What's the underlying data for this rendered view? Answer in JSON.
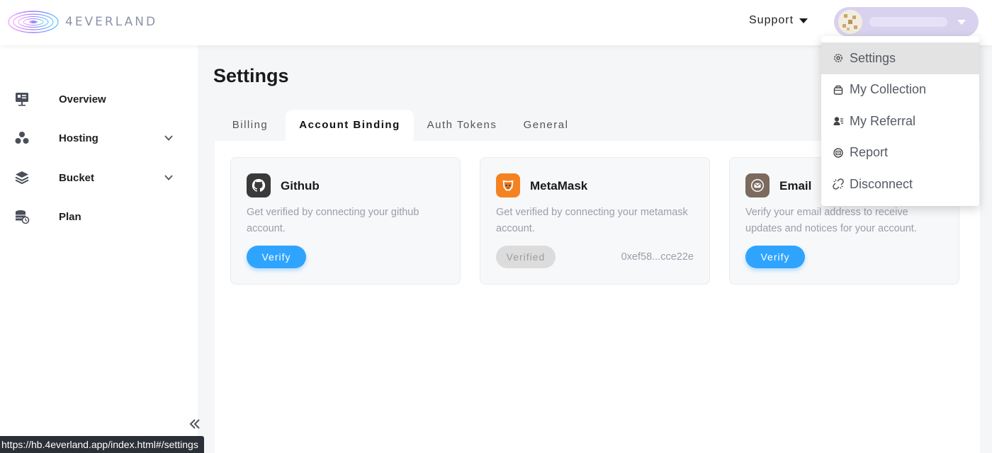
{
  "header": {
    "brand": "4EVERLAND",
    "support_label": "Support"
  },
  "sidebar": {
    "items": [
      {
        "label": "Overview",
        "icon": "overview-icon"
      },
      {
        "label": "Hosting",
        "icon": "hosting-icon",
        "expandable": true
      },
      {
        "label": "Bucket",
        "icon": "bucket-icon",
        "expandable": true
      },
      {
        "label": "Plan",
        "icon": "plan-icon"
      }
    ]
  },
  "main": {
    "title": "Settings",
    "tabs": [
      {
        "label": "Billing"
      },
      {
        "label": "Account Binding",
        "active": true
      },
      {
        "label": "Auth Tokens"
      },
      {
        "label": "General"
      }
    ],
    "cards": [
      {
        "title": "Github",
        "description": "Get verified by connecting your github account.",
        "button": "Verify",
        "icon": "github-icon"
      },
      {
        "title": "MetaMask",
        "description": "Get verified by connecting your metamask account.",
        "button": "Verified",
        "address": "0xef58...cce22e",
        "icon": "metamask-icon"
      },
      {
        "title": "Email",
        "description": "Verify your email address to receive updates and notices for your account.",
        "button": "Verify",
        "icon": "email-icon"
      }
    ]
  },
  "dropdown": {
    "items": [
      {
        "label": "Settings",
        "icon": "gear-icon",
        "active": true
      },
      {
        "label": "My Collection",
        "icon": "collection-icon"
      },
      {
        "label": "My Referral",
        "icon": "referral-icon"
      },
      {
        "label": "Report",
        "icon": "report-icon"
      },
      {
        "label": "Disconnect",
        "icon": "disconnect-icon"
      }
    ]
  },
  "status_bar": {
    "url": "https://hb.4everland.app/index.html#/settings"
  },
  "colors": {
    "accent": "#2fa4ff",
    "metamask": "#f58220",
    "github": "#3a3a3a",
    "email": "#7b6a5d"
  }
}
